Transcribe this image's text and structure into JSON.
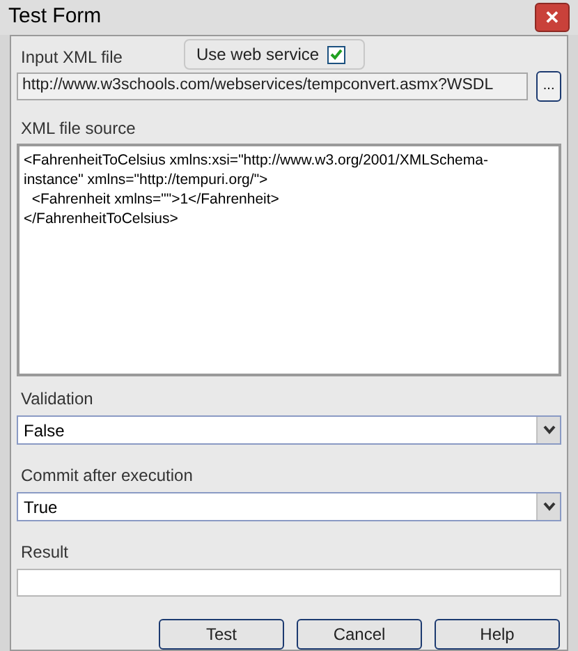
{
  "window": {
    "title": "Test Form",
    "close_label": "✕"
  },
  "input_xml_file": {
    "label": "Input XML file",
    "value": "http://www.w3schools.com/webservices/tempconvert.asmx?WSDL",
    "browse_label": "..."
  },
  "use_web_service": {
    "label": "Use web service",
    "checked": true
  },
  "xml_file_source": {
    "label": "XML file source",
    "lines": [
      "<FahrenheitToCelsius xmlns:xsi=\"http://www.w3.org/2001/XMLSchema-",
      "instance\" xmlns=\"http://tempuri.org/\">",
      "  <Fahrenheit xmlns=\"\">1</Fahrenheit>",
      "</FahrenheitToCelsius>"
    ]
  },
  "validation": {
    "label": "Validation",
    "value": "False"
  },
  "commit_after_execution": {
    "label": "Commit after execution",
    "value": "True"
  },
  "result": {
    "label": "Result"
  },
  "buttons": [
    "Test",
    "Cancel",
    "Help"
  ]
}
